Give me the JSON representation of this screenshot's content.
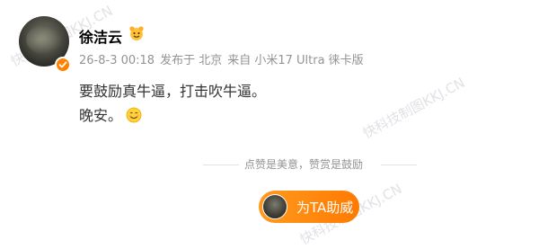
{
  "post": {
    "author": {
      "name": "徐洁云",
      "verified": true
    },
    "meta": {
      "timestamp": "26-8-3 00:18",
      "location": "发布于 北京",
      "source": "来自 小米17 Ultra 徕卡版"
    },
    "content": {
      "line1": "要鼓励真牛逼，打击吹牛逼。",
      "line2": "晚安。"
    }
  },
  "reward": {
    "slogan": "点赞是美意，赞赏是鼓励",
    "button_label": "为TA助威"
  },
  "watermark": {
    "text": "快科技制图KKJ.CN"
  },
  "colors": {
    "accent": "#ff8200",
    "meta_text": "#939393"
  }
}
